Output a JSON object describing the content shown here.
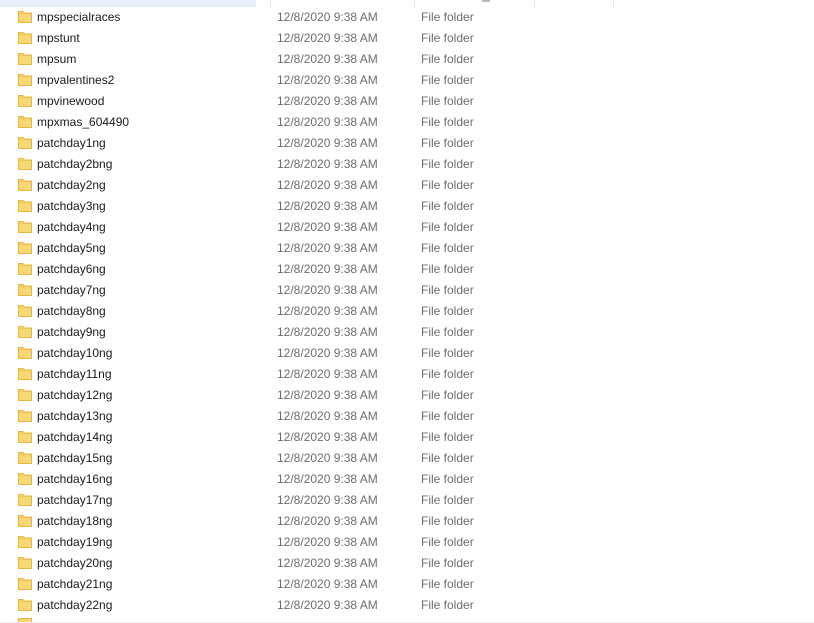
{
  "colors": {
    "folder_body": "#f8d775",
    "folder_tab": "#e7b640",
    "header_selected": "#e5f0fb",
    "secondary_text": "#6d6d6d"
  },
  "files": [
    {
      "name": "mpspecialraces",
      "date": "12/8/2020 9:38 AM",
      "type": "File folder",
      "icon": "folder-icon"
    },
    {
      "name": "mpstunt",
      "date": "12/8/2020 9:38 AM",
      "type": "File folder",
      "icon": "folder-icon"
    },
    {
      "name": "mpsum",
      "date": "12/8/2020 9:38 AM",
      "type": "File folder",
      "icon": "folder-icon"
    },
    {
      "name": "mpvalentines2",
      "date": "12/8/2020 9:38 AM",
      "type": "File folder",
      "icon": "folder-icon"
    },
    {
      "name": "mpvinewood",
      "date": "12/8/2020 9:38 AM",
      "type": "File folder",
      "icon": "folder-icon"
    },
    {
      "name": "mpxmas_604490",
      "date": "12/8/2020 9:38 AM",
      "type": "File folder",
      "icon": "folder-icon"
    },
    {
      "name": "patchday1ng",
      "date": "12/8/2020 9:38 AM",
      "type": "File folder",
      "icon": "folder-icon"
    },
    {
      "name": "patchday2bng",
      "date": "12/8/2020 9:38 AM",
      "type": "File folder",
      "icon": "folder-icon"
    },
    {
      "name": "patchday2ng",
      "date": "12/8/2020 9:38 AM",
      "type": "File folder",
      "icon": "folder-icon"
    },
    {
      "name": "patchday3ng",
      "date": "12/8/2020 9:38 AM",
      "type": "File folder",
      "icon": "folder-icon"
    },
    {
      "name": "patchday4ng",
      "date": "12/8/2020 9:38 AM",
      "type": "File folder",
      "icon": "folder-icon"
    },
    {
      "name": "patchday5ng",
      "date": "12/8/2020 9:38 AM",
      "type": "File folder",
      "icon": "folder-icon"
    },
    {
      "name": "patchday6ng",
      "date": "12/8/2020 9:38 AM",
      "type": "File folder",
      "icon": "folder-icon"
    },
    {
      "name": "patchday7ng",
      "date": "12/8/2020 9:38 AM",
      "type": "File folder",
      "icon": "folder-icon"
    },
    {
      "name": "patchday8ng",
      "date": "12/8/2020 9:38 AM",
      "type": "File folder",
      "icon": "folder-icon"
    },
    {
      "name": "patchday9ng",
      "date": "12/8/2020 9:38 AM",
      "type": "File folder",
      "icon": "folder-icon"
    },
    {
      "name": "patchday10ng",
      "date": "12/8/2020 9:38 AM",
      "type": "File folder",
      "icon": "folder-icon"
    },
    {
      "name": "patchday11ng",
      "date": "12/8/2020 9:38 AM",
      "type": "File folder",
      "icon": "folder-icon"
    },
    {
      "name": "patchday12ng",
      "date": "12/8/2020 9:38 AM",
      "type": "File folder",
      "icon": "folder-icon"
    },
    {
      "name": "patchday13ng",
      "date": "12/8/2020 9:38 AM",
      "type": "File folder",
      "icon": "folder-icon"
    },
    {
      "name": "patchday14ng",
      "date": "12/8/2020 9:38 AM",
      "type": "File folder",
      "icon": "folder-icon"
    },
    {
      "name": "patchday15ng",
      "date": "12/8/2020 9:38 AM",
      "type": "File folder",
      "icon": "folder-icon"
    },
    {
      "name": "patchday16ng",
      "date": "12/8/2020 9:38 AM",
      "type": "File folder",
      "icon": "folder-icon"
    },
    {
      "name": "patchday17ng",
      "date": "12/8/2020 9:38 AM",
      "type": "File folder",
      "icon": "folder-icon"
    },
    {
      "name": "patchday18ng",
      "date": "12/8/2020 9:38 AM",
      "type": "File folder",
      "icon": "folder-icon"
    },
    {
      "name": "patchday19ng",
      "date": "12/8/2020 9:38 AM",
      "type": "File folder",
      "icon": "folder-icon"
    },
    {
      "name": "patchday20ng",
      "date": "12/8/2020 9:38 AM",
      "type": "File folder",
      "icon": "folder-icon"
    },
    {
      "name": "patchday21ng",
      "date": "12/8/2020 9:38 AM",
      "type": "File folder",
      "icon": "folder-icon"
    },
    {
      "name": "patchday22ng",
      "date": "12/8/2020 9:38 AM",
      "type": "File folder",
      "icon": "folder-icon"
    }
  ]
}
